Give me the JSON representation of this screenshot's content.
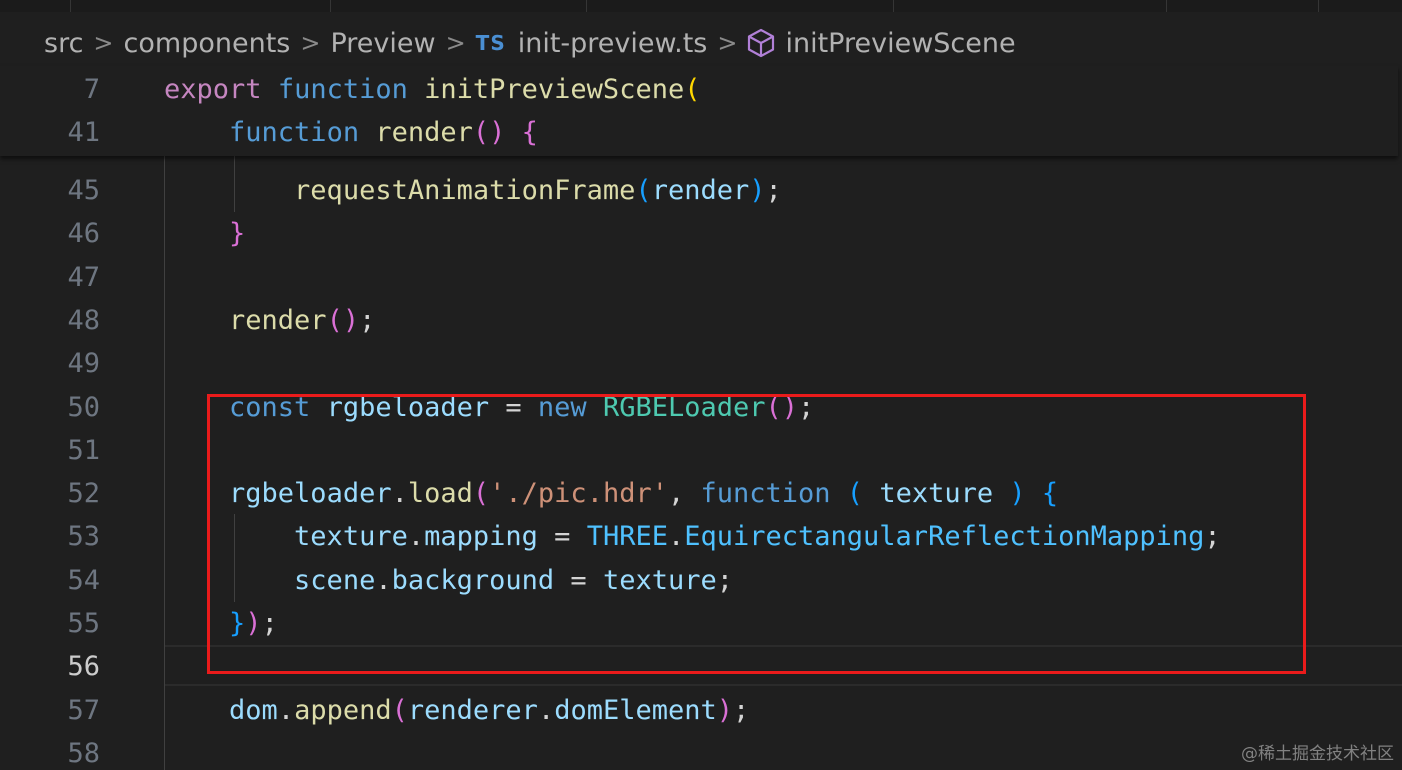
{
  "breadcrumb": {
    "items": [
      "src",
      "components",
      "Preview",
      "init-preview.ts",
      "initPreviewScene"
    ],
    "file_icon_text": "TS",
    "separator": ">"
  },
  "sticky_lines": [
    {
      "number": "7",
      "tokens": [
        [
          "kw",
          "export"
        ],
        [
          "pn",
          " "
        ],
        [
          "st",
          "function"
        ],
        [
          "pn",
          " "
        ],
        [
          "fn",
          "initPreviewScene"
        ],
        [
          "b1",
          "("
        ]
      ]
    },
    {
      "number": "41",
      "tokens": [
        [
          "pn",
          "    "
        ],
        [
          "st",
          "function"
        ],
        [
          "pn",
          " "
        ],
        [
          "fn",
          "render"
        ],
        [
          "b2",
          "()"
        ],
        [
          "pn",
          " "
        ],
        [
          "b2",
          "{"
        ]
      ]
    }
  ],
  "lines": [
    {
      "number": "45",
      "tokens": [
        [
          "pn",
          "        "
        ],
        [
          "fn",
          "requestAnimationFrame"
        ],
        [
          "b3",
          "("
        ],
        [
          "vr",
          "render"
        ],
        [
          "b3",
          ")"
        ],
        [
          "pn",
          ";"
        ]
      ]
    },
    {
      "number": "46",
      "tokens": [
        [
          "pn",
          "    "
        ],
        [
          "b2",
          "}"
        ]
      ]
    },
    {
      "number": "47",
      "tokens": []
    },
    {
      "number": "48",
      "tokens": [
        [
          "pn",
          "    "
        ],
        [
          "fn",
          "render"
        ],
        [
          "b2",
          "()"
        ],
        [
          "pn",
          ";"
        ]
      ]
    },
    {
      "number": "49",
      "tokens": []
    },
    {
      "number": "50",
      "tokens": [
        [
          "pn",
          "    "
        ],
        [
          "st",
          "const"
        ],
        [
          "pn",
          " "
        ],
        [
          "vr",
          "rgbeloader"
        ],
        [
          "pn",
          " = "
        ],
        [
          "st",
          "new"
        ],
        [
          "pn",
          " "
        ],
        [
          "ty",
          "RGBELoader"
        ],
        [
          "b2",
          "()"
        ],
        [
          "pn",
          ";"
        ]
      ]
    },
    {
      "number": "51",
      "tokens": []
    },
    {
      "number": "52",
      "tokens": [
        [
          "pn",
          "    "
        ],
        [
          "vr",
          "rgbeloader"
        ],
        [
          "pn",
          "."
        ],
        [
          "fn",
          "load"
        ],
        [
          "b2",
          "("
        ],
        [
          "str",
          "'./pic.hdr'"
        ],
        [
          "pn",
          ", "
        ],
        [
          "st",
          "function"
        ],
        [
          "pn",
          " "
        ],
        [
          "b3",
          "("
        ],
        [
          "pn",
          " "
        ],
        [
          "vr",
          "texture"
        ],
        [
          "pn",
          " "
        ],
        [
          "b3",
          ")"
        ],
        [
          "pn",
          " "
        ],
        [
          "b3",
          "{"
        ]
      ]
    },
    {
      "number": "53",
      "tokens": [
        [
          "pn",
          "        "
        ],
        [
          "vr",
          "texture"
        ],
        [
          "pn",
          "."
        ],
        [
          "vr",
          "mapping"
        ],
        [
          "pn",
          " = "
        ],
        [
          "cn",
          "THREE"
        ],
        [
          "pn",
          "."
        ],
        [
          "cn",
          "EquirectangularReflectionMapping"
        ],
        [
          "pn",
          ";"
        ]
      ]
    },
    {
      "number": "54",
      "tokens": [
        [
          "pn",
          "        "
        ],
        [
          "vr",
          "scene"
        ],
        [
          "pn",
          "."
        ],
        [
          "vr",
          "background"
        ],
        [
          "pn",
          " = "
        ],
        [
          "vr",
          "texture"
        ],
        [
          "pn",
          ";"
        ]
      ]
    },
    {
      "number": "55",
      "tokens": [
        [
          "pn",
          "    "
        ],
        [
          "b3",
          "}"
        ],
        [
          "b2",
          ")"
        ],
        [
          "pn",
          ";"
        ]
      ]
    },
    {
      "number": "56",
      "tokens": [],
      "active": true
    },
    {
      "number": "57",
      "tokens": [
        [
          "pn",
          "    "
        ],
        [
          "vr",
          "dom"
        ],
        [
          "pn",
          "."
        ],
        [
          "fn",
          "append"
        ],
        [
          "b2",
          "("
        ],
        [
          "vr",
          "renderer"
        ],
        [
          "pn",
          "."
        ],
        [
          "vr",
          "domElement"
        ],
        [
          "b2",
          ")"
        ],
        [
          "pn",
          ";"
        ]
      ]
    },
    {
      "number": "58",
      "tokens": []
    }
  ],
  "watermark": "@稀土掘金技术社区"
}
